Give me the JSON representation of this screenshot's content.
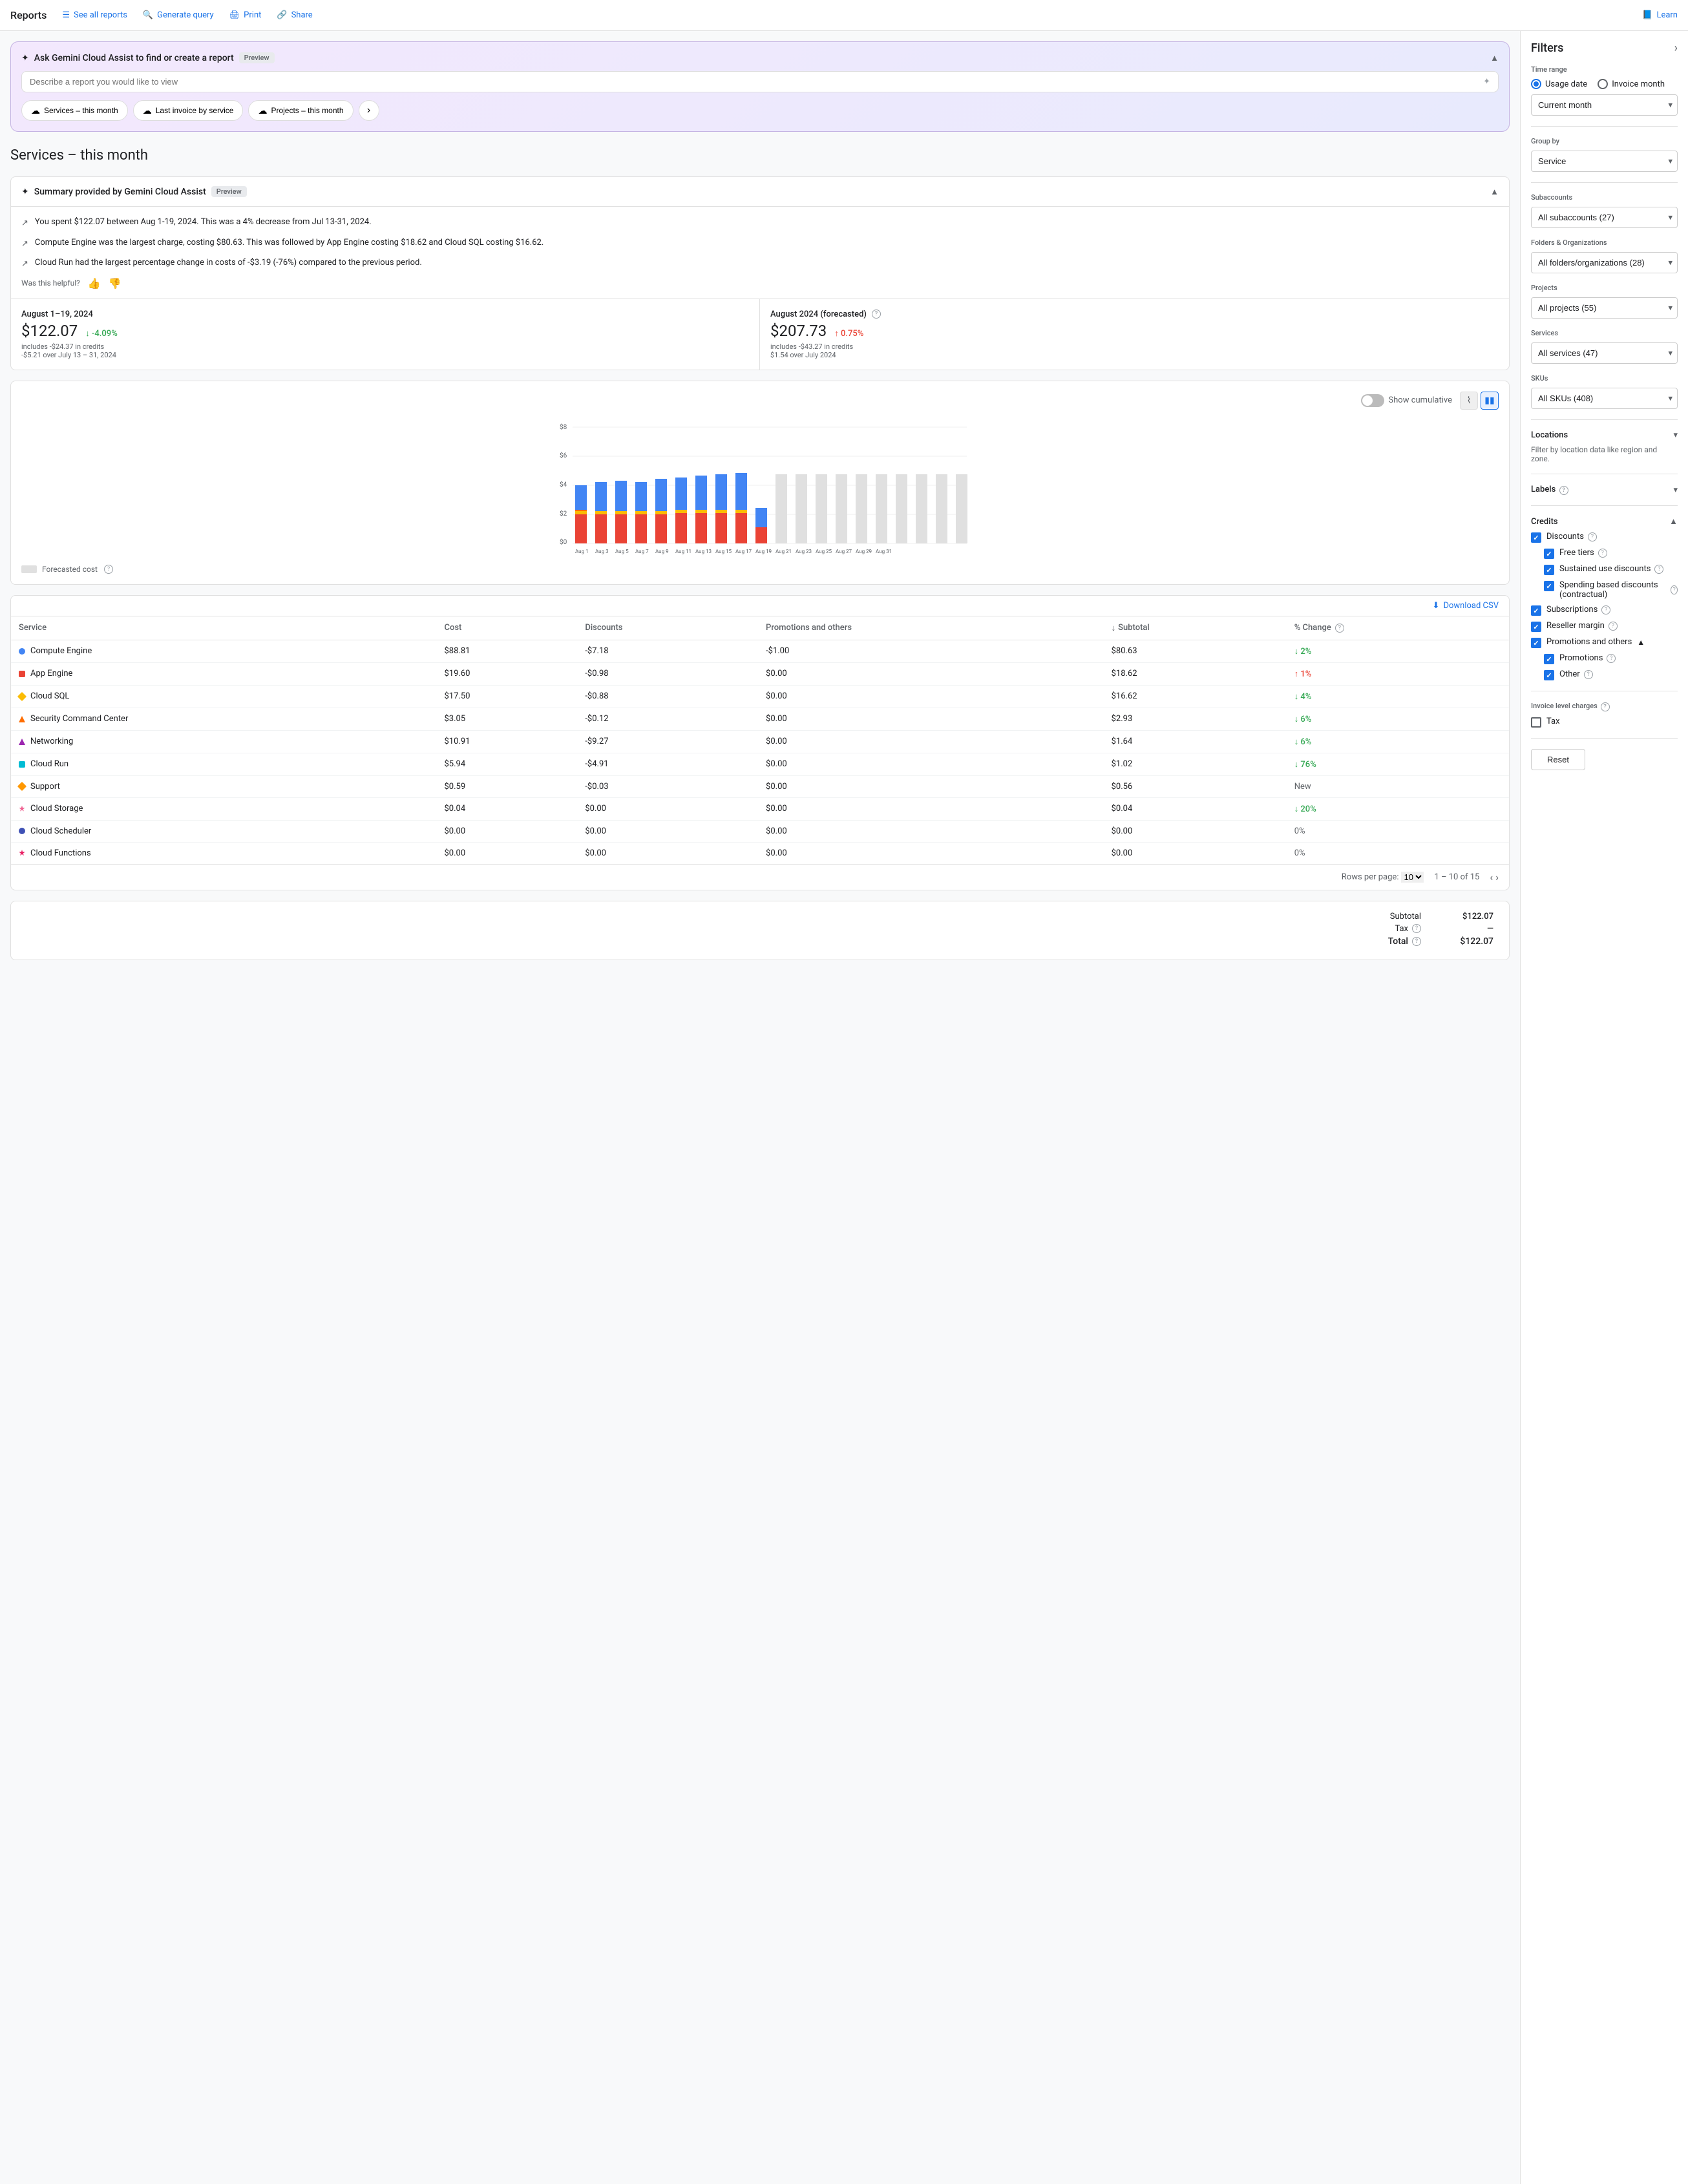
{
  "app": {
    "title": "Reports"
  },
  "nav": {
    "see_all_reports": "See all reports",
    "generate_query": "Generate query",
    "print": "Print",
    "share": "Share",
    "learn": "Learn"
  },
  "gemini": {
    "title": "Ask Gemini Cloud Assist to find or create a report",
    "badge": "Preview",
    "placeholder": "Describe a report you would like to view",
    "quick_reports": [
      "Services – this month",
      "Last invoice by service",
      "Projects – this month"
    ]
  },
  "page_title": "Services – this month",
  "summary": {
    "title": "Summary provided by Gemini Cloud Assist",
    "badge": "Preview",
    "items": [
      "You spent $122.07 between Aug 1-19, 2024. This was a 4% decrease from Jul 13-31, 2024.",
      "Compute Engine was the largest charge, costing $80.63. This was followed by App Engine costing $18.62 and Cloud SQL costing $16.62.",
      "Cloud Run had the largest percentage change in costs of -$3.19 (-76%) compared to the previous period."
    ],
    "helpful_label": "Was this helpful?"
  },
  "metrics": {
    "current": {
      "period": "August 1–19, 2024",
      "amount": "$122.07",
      "sub": "includes -$24.37 in credits",
      "change": "↓ -4.09%",
      "change_type": "down",
      "change_sub": "-$5.21 over July 13 – 31, 2024"
    },
    "forecasted": {
      "period": "August 2024 (forecasted)",
      "amount": "$207.73",
      "sub": "includes -$43.27 in credits",
      "change": "↑ 0.75%",
      "change_type": "up",
      "change_sub": "$1.54 over July 2024"
    }
  },
  "chart": {
    "show_cumulative": "Show cumulative",
    "y_max": "$8",
    "y_labels": [
      "$8",
      "$6",
      "$4",
      "$2",
      "$0"
    ],
    "x_labels": [
      "Aug 1",
      "Aug 3",
      "Aug 5",
      "Aug 7",
      "Aug 9",
      "Aug 11",
      "Aug 13",
      "Aug 15",
      "Aug 17",
      "Aug 19",
      "Aug 21",
      "Aug 23",
      "Aug 25",
      "Aug 27",
      "Aug 29",
      "Aug 31"
    ],
    "forecasted_label": "Forecasted cost"
  },
  "table": {
    "download_csv": "Download CSV",
    "columns": [
      "Service",
      "Cost",
      "Discounts",
      "Promotions and others",
      "Subtotal",
      "% Change"
    ],
    "rows": [
      {
        "service": "Compute Engine",
        "color": "#4285f4",
        "shape": "circle",
        "cost": "$88.81",
        "discounts": "-$7.18",
        "promotions": "-$1.00",
        "subtotal": "$80.63",
        "change": "2%",
        "change_type": "down"
      },
      {
        "service": "App Engine",
        "color": "#ea4335",
        "shape": "square",
        "cost": "$19.60",
        "discounts": "-$0.98",
        "promotions": "$0.00",
        "subtotal": "$18.62",
        "change": "1%",
        "change_type": "up"
      },
      {
        "service": "Cloud SQL",
        "color": "#fbbc04",
        "shape": "diamond",
        "cost": "$17.50",
        "discounts": "-$0.88",
        "promotions": "$0.00",
        "subtotal": "$16.62",
        "change": "4%",
        "change_type": "down"
      },
      {
        "service": "Security Command Center",
        "color": "#ff6d00",
        "shape": "triangle",
        "cost": "$3.05",
        "discounts": "-$0.12",
        "promotions": "$0.00",
        "subtotal": "$2.93",
        "change": "6%",
        "change_type": "down"
      },
      {
        "service": "Networking",
        "color": "#9c27b0",
        "shape": "triangle",
        "cost": "$10.91",
        "discounts": "-$9.27",
        "promotions": "$0.00",
        "subtotal": "$1.64",
        "change": "6%",
        "change_type": "down"
      },
      {
        "service": "Cloud Run",
        "color": "#00bcd4",
        "shape": "square",
        "cost": "$5.94",
        "discounts": "-$4.91",
        "promotions": "$0.00",
        "subtotal": "$1.02",
        "change": "76%",
        "change_type": "down"
      },
      {
        "service": "Support",
        "color": "#ff9800",
        "shape": "diamond",
        "cost": "$0.59",
        "discounts": "-$0.03",
        "promotions": "$0.00",
        "subtotal": "$0.56",
        "change": "New",
        "change_type": "neutral"
      },
      {
        "service": "Cloud Storage",
        "color": "#f06292",
        "shape": "star",
        "cost": "$0.04",
        "discounts": "$0.00",
        "promotions": "$0.00",
        "subtotal": "$0.04",
        "change": "20%",
        "change_type": "down"
      },
      {
        "service": "Cloud Scheduler",
        "color": "#3f51b5",
        "shape": "circle",
        "cost": "$0.00",
        "discounts": "$0.00",
        "promotions": "$0.00",
        "subtotal": "$0.00",
        "change": "0%",
        "change_type": "neutral"
      },
      {
        "service": "Cloud Functions",
        "color": "#e91e63",
        "shape": "star",
        "cost": "$0.00",
        "discounts": "$0.00",
        "promotions": "$0.00",
        "subtotal": "$0.00",
        "change": "0%",
        "change_type": "neutral"
      }
    ],
    "pagination": {
      "rows_per_page": "Rows per page:",
      "per_page": "10",
      "range": "1 – 10 of 15"
    }
  },
  "totals": {
    "subtotal_label": "Subtotal",
    "subtotal_value": "$122.07",
    "tax_label": "Tax",
    "tax_value": "—",
    "total_label": "Total",
    "total_value": "$122.07"
  },
  "filters": {
    "title": "Filters",
    "time_range_label": "Time range",
    "usage_date_label": "Usage date",
    "invoice_month_label": "Invoice month",
    "current_month_label": "Current month",
    "group_by_label": "Group by",
    "group_by_value": "Service",
    "subaccounts_label": "Subaccounts",
    "subaccounts_value": "All subaccounts (27)",
    "folders_label": "Folders & Organizations",
    "folders_value": "All folders/organizations (28)",
    "projects_label": "Projects",
    "projects_value": "All projects (55)",
    "services_label": "Services",
    "services_value": "All services (47)",
    "skus_label": "SKUs",
    "skus_value": "All SKUs (408)",
    "locations_label": "Locations",
    "locations_sub": "Filter by location data like region and zone.",
    "labels_label": "Labels",
    "credits_label": "Credits",
    "discounts_label": "Discounts",
    "free_tiers_label": "Free tiers",
    "sustained_label": "Sustained use discounts",
    "spending_label": "Spending based discounts (contractual)",
    "subscriptions_label": "Subscriptions",
    "reseller_label": "Reseller margin",
    "promotions_label": "Promotions and others",
    "promotions_sub_label": "Promotions",
    "other_label": "Other",
    "invoice_charges_label": "Invoice level charges",
    "tax_label": "Tax",
    "reset_label": "Reset"
  }
}
